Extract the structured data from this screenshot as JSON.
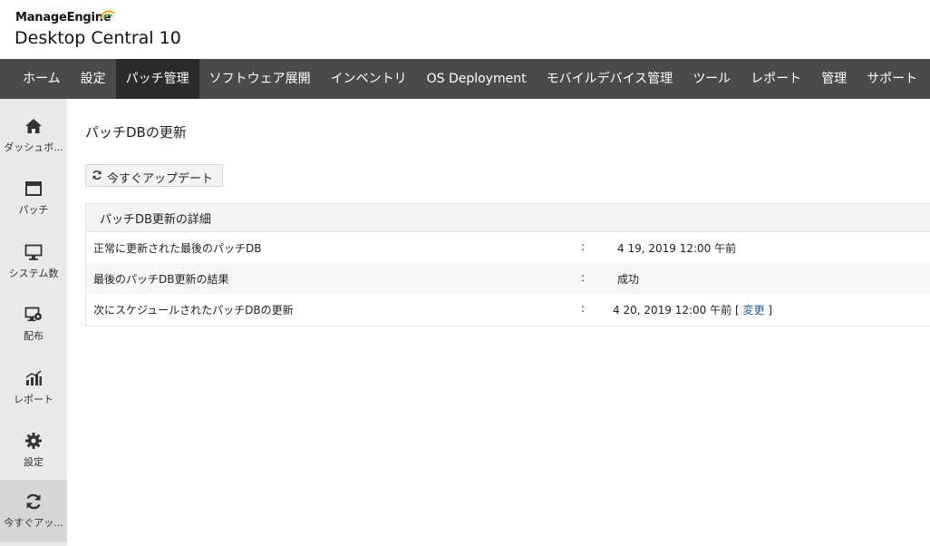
{
  "brand": {
    "company": "ManageEngine",
    "product": "Desktop Central 10"
  },
  "nav": {
    "items": [
      {
        "label": "ホーム",
        "active": false
      },
      {
        "label": "設定",
        "active": false
      },
      {
        "label": "パッチ管理",
        "active": true
      },
      {
        "label": "ソフトウェア展開",
        "active": false
      },
      {
        "label": "インベントリ",
        "active": false
      },
      {
        "label": "OS Deployment",
        "active": false
      },
      {
        "label": "モバイルデバイス管理",
        "active": false
      },
      {
        "label": "ツール",
        "active": false
      },
      {
        "label": "レポート",
        "active": false
      },
      {
        "label": "管理",
        "active": false
      },
      {
        "label": "サポート",
        "active": false
      }
    ]
  },
  "sidebar": {
    "items": [
      {
        "label": "ダッシュボ...",
        "icon": "home-icon"
      },
      {
        "label": "パッチ",
        "icon": "window-icon"
      },
      {
        "label": "システム数",
        "icon": "monitor-icon"
      },
      {
        "label": "配布",
        "icon": "deploy-icon"
      },
      {
        "label": "レポート",
        "icon": "chart-icon"
      },
      {
        "label": "設定",
        "icon": "gear-icon"
      },
      {
        "label": "今すぐアッ...",
        "icon": "refresh-icon",
        "active": true
      }
    ]
  },
  "main": {
    "title": "パッチDBの更新",
    "update_button": "今すぐアップデート",
    "panel": {
      "title": "パッチDB更新の詳細",
      "rows": [
        {
          "label": "正常に更新された最後のパッチDB",
          "sep": ":",
          "value": "4 19, 2019 12:00 午前"
        },
        {
          "label": "最後のパッチDB更新の結果",
          "sep": ":",
          "value": "成功"
        },
        {
          "label": "次にスケジュールされたパッチDBの更新",
          "sep": ":",
          "value": "4 20, 2019 12:00 午前",
          "bracket_open": "[",
          "link": "変更",
          "bracket_close": "]"
        }
      ]
    }
  },
  "colors": {
    "nav_bg": "#4a4a4a",
    "nav_active": "#2b2b2b",
    "sidebar_bg": "#e9e9e9",
    "link": "#1a5fa8",
    "brand_accent": "#f5a623"
  }
}
